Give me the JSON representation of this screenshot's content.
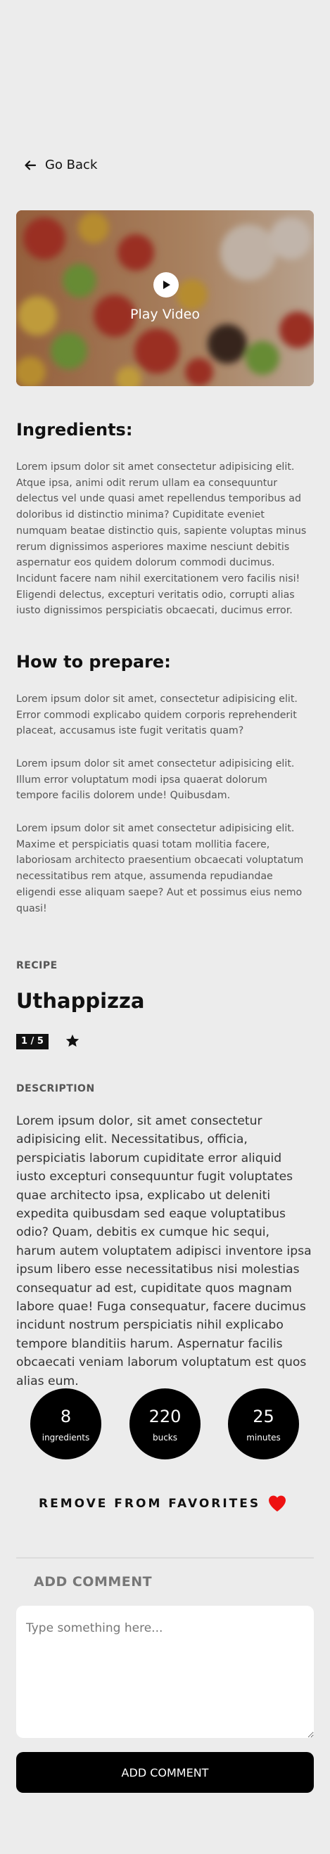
{
  "nav": {
    "back_label": "Go Back"
  },
  "video": {
    "play_label": "Play Video"
  },
  "ingredients": {
    "heading": "Ingredients:",
    "text": "Lorem ipsum dolor sit amet consectetur adipisicing elit. Atque ipsa, animi odit rerum ullam ea consequuntur delectus vel unde quasi amet repellendus temporibus ad doloribus id distinctio minima? Cupiditate eveniet numquam beatae distinctio quis, sapiente voluptas minus rerum dignissimos asperiores maxime nesciunt debitis aspernatur eos quidem dolorum commodi ducimus. Incidunt facere nam nihil exercitationem vero facilis nisi! Eligendi delectus, excepturi veritatis odio, corrupti alias iusto dignissimos perspiciatis obcaecati, ducimus error."
  },
  "prepare": {
    "heading": "How to prepare:",
    "paragraphs": [
      "Lorem ipsum dolor sit amet, consectetur adipisicing elit. Error commodi explicabo quidem corporis reprehenderit placeat, accusamus iste fugit veritatis quam?",
      "Lorem ipsum dolor sit amet consectetur adipisicing elit. Illum error voluptatum modi ipsa quaerat dolorum tempore facilis dolorem unde! Quibusdam.",
      "Lorem ipsum dolor sit amet consectetur adipisicing elit. Maxime et perspiciatis quasi totam mollitia facere, laboriosam architecto praesentium obcaecati voluptatum necessitatibus rem atque, assumenda repudiandae eligendi esse aliquam saepe? Aut et possimus eius nemo quasi!"
    ]
  },
  "recipe": {
    "kicker": "RECIPE",
    "name": "Uthappizza",
    "rating": "1 / 5",
    "description_kicker": "DESCRIPTION",
    "description": "Lorem ipsum dolor, sit amet consectetur adipisicing elit. Necessitatibus, officia, perspiciatis laborum cupiditate error aliquid iusto excepturi consequuntur fugit voluptates quae architecto ipsa, explicabo ut deleniti expedita quibusdam sed eaque voluptatibus odio? Quam, debitis ex cumque hic sequi, harum autem voluptatem adipisci inventore ipsa ipsum libero esse necessitatibus nisi molestias consequatur ad est, cupiditate quos magnam labore quae! Fuga consequatur, facere ducimus incidunt nostrum perspiciatis nihil explicabo tempore blanditiis harum. Aspernatur facilis obcaecati veniam laborum voluptatum est quos alias eum."
  },
  "stats": [
    {
      "value": "8",
      "label": "ingredients"
    },
    {
      "value": "220",
      "label": "bucks"
    },
    {
      "value": "25",
      "label": "minutes"
    }
  ],
  "favorites": {
    "label": "REMOVE FROM FAVORITES",
    "heart_color": "#ee1111"
  },
  "comment": {
    "title": "ADD COMMENT",
    "placeholder": "Type something here...",
    "submit_label": "ADD COMMENT"
  }
}
